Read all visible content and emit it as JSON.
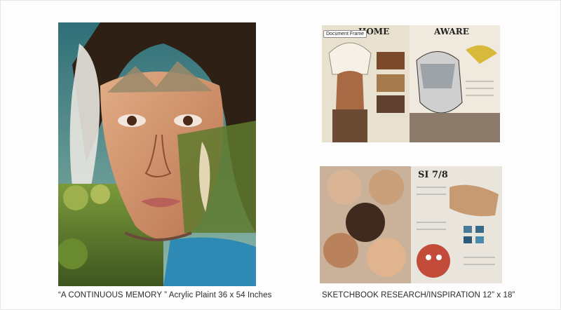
{
  "captions": {
    "main_artwork": "“A CONTINUOUS MEMORY ” Acrylic Plaint 36 x 54 Inches",
    "sketchbook": "SKETCHBOOK RESEARCH/INSPIRATION  12” x 18”"
  },
  "frame_label": "Document Frame",
  "sketch_top_headings": [
    "HOME",
    "AWARE"
  ],
  "sketch_bottom_heading": "SI 7/8",
  "colors": {
    "sky": "#3d7d84",
    "skin": "#d39a72",
    "forest": "#5f7a2e",
    "shirt_blue": "#2e8ab5",
    "hair": "#2f2016"
  }
}
